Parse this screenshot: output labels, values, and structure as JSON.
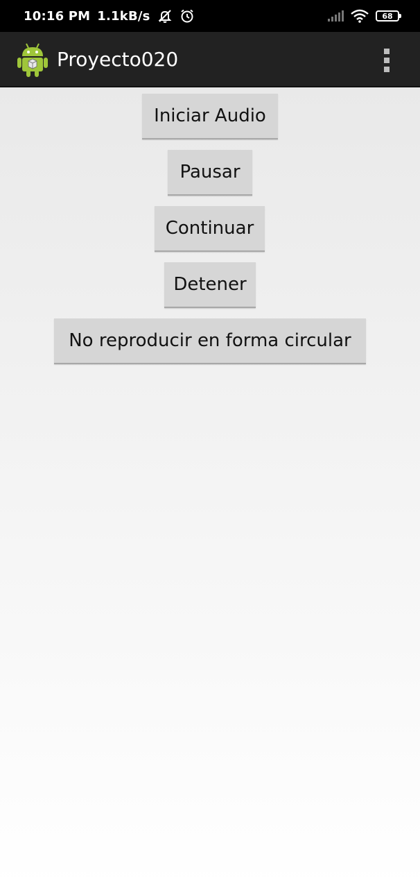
{
  "status_bar": {
    "time": "10:16 PM",
    "network_speed": "1.1kB/s",
    "icons": [
      "muted-bell-icon",
      "alarm-icon",
      "signal-icon",
      "wifi-icon",
      "battery-icon"
    ],
    "battery_level": "68"
  },
  "action_bar": {
    "app_icon": "android-robot-icon",
    "title": "Proyecto020",
    "overflow_icon": "overflow-menu-icon"
  },
  "buttons": {
    "start": "Iniciar Audio",
    "pause": "Pausar",
    "continue": "Continuar",
    "stop": "Detener",
    "loop": "No reproducir en forma circular"
  },
  "colors": {
    "action_bar_bg": "#222222",
    "button_bg": "#d6d6d6",
    "android_green": "#9fc63a"
  }
}
